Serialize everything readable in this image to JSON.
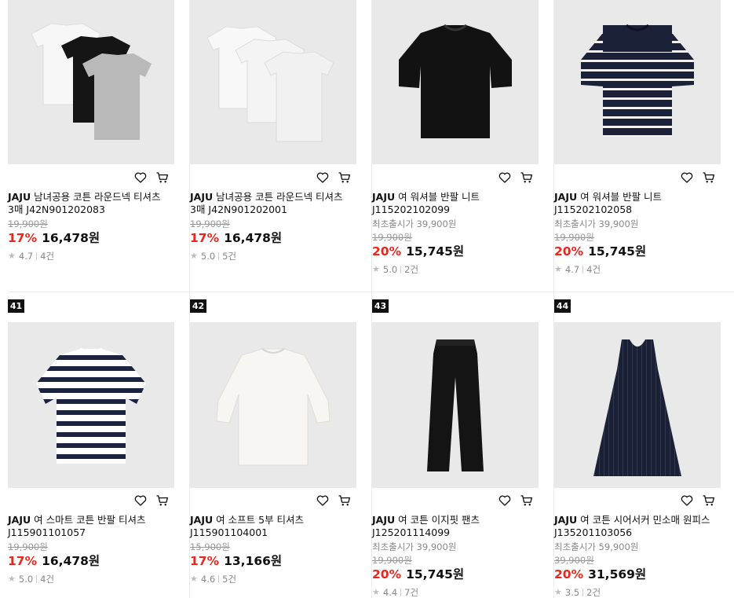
{
  "products": [
    {
      "brand": "JAJU",
      "title": "남녀공용 코튼 라운드넥 티셔츠 3매 J42N901202083",
      "launch": "",
      "original": "19,900원",
      "discount": "17%",
      "price": "16,478원",
      "rating": "4.7",
      "reviews": "4건",
      "image": "three-tees-white-black-gray",
      "rank": ""
    },
    {
      "brand": "JAJU",
      "title": "남녀공용 코튼 라운드넥 티셔츠 3매 J42N901202001",
      "launch": "",
      "original": "19,900원",
      "discount": "17%",
      "price": "16,478원",
      "rating": "5.0",
      "reviews": "5건",
      "image": "three-tees-white",
      "rank": ""
    },
    {
      "brand": "JAJU",
      "title": "여 워셔블 반팔 니트 J115202102099",
      "launch": "최초출시가 39,900원",
      "original": "19,900원",
      "discount": "20%",
      "price": "15,745원",
      "rating": "5.0",
      "reviews": "2건",
      "image": "black-knit",
      "rank": ""
    },
    {
      "brand": "JAJU",
      "title": "여 워셔블 반팔 니트 J115202102058",
      "launch": "최초출시가 39,900원",
      "original": "19,900원",
      "discount": "20%",
      "price": "15,745원",
      "rating": "4.7",
      "reviews": "4건",
      "image": "navy-stripe-knit",
      "rank": ""
    },
    {
      "brand": "JAJU",
      "title": "여 스마트 코튼 반팔 티셔츠 J115901101057",
      "launch": "",
      "original": "19,900원",
      "discount": "17%",
      "price": "16,478원",
      "rating": "5.0",
      "reviews": "4건",
      "image": "stripe-tee",
      "rank": "41"
    },
    {
      "brand": "JAJU",
      "title": "여 소프트 5부 티셔츠 J115901104001",
      "launch": "",
      "original": "15,900원",
      "discount": "17%",
      "price": "13,166원",
      "rating": "4.6",
      "reviews": "5건",
      "image": "white-tee-long",
      "rank": "42"
    },
    {
      "brand": "JAJU",
      "title": "여 코튼 이지핏 팬츠 J125201114099",
      "launch": "최초출시가 39,900원",
      "original": "19,900원",
      "discount": "20%",
      "price": "15,745원",
      "rating": "4.4",
      "reviews": "7건",
      "image": "black-pants",
      "rank": "43"
    },
    {
      "brand": "JAJU",
      "title": "여 코튼 시어서커 민소매 원피스 J135201103056",
      "launch": "최초출시가 59,900원",
      "original": "39,900원",
      "discount": "20%",
      "price": "31,569원",
      "rating": "3.5",
      "reviews": "2건",
      "image": "navy-dress",
      "rank": "44"
    }
  ],
  "icons": {
    "wishlist": "heart-icon",
    "cart": "cart-icon",
    "star": "star-icon"
  },
  "colors": {
    "discount": "#e8281e",
    "thumb_bg": "#e9e9e9",
    "rank_bg": "#111111"
  }
}
